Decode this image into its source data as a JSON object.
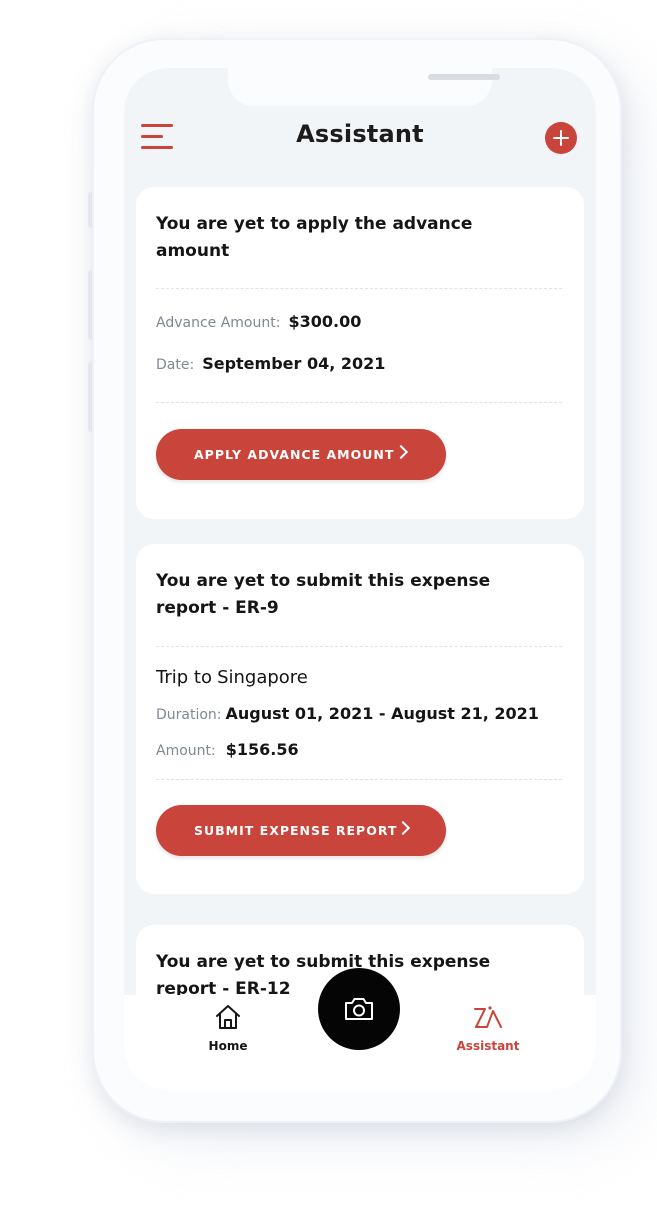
{
  "header": {
    "title": "Assistant",
    "menu_icon": "hamburger-menu-icon",
    "add_icon": "plus-circle-icon"
  },
  "cards": [
    {
      "title": "You are yet to apply the advance amount",
      "fields": [
        {
          "label": "Advance Amount:",
          "value": "$300.00"
        },
        {
          "label": "Date:",
          "value": "September 04, 2021"
        }
      ],
      "button_label": "APPLY ADVANCE AMOUNT"
    },
    {
      "title": "You are yet to submit this expense report - ER-9",
      "trip_prefix": "Trip to",
      "trip_destination": "Singapore",
      "fields": [
        {
          "label": "Duration:",
          "value": "August 01, 2021 - August 21, 2021"
        },
        {
          "label": "Amount:",
          "value": "$156.56"
        }
      ],
      "button_label": "SUBMIT EXPENSE REPORT"
    },
    {
      "title": "You are yet to submit this expense report - ER-12"
    }
  ],
  "tabbar": {
    "home_label": "Home",
    "assistant_label": "Assistant",
    "camera_icon": "camera-icon",
    "home_icon": "home-icon",
    "assistant_icon": "assistant-logo-icon"
  },
  "colors": {
    "accent": "#c9443a",
    "background": "#f2f5f8",
    "card": "#ffffff",
    "text": "#151515",
    "muted": "#7f8893"
  }
}
